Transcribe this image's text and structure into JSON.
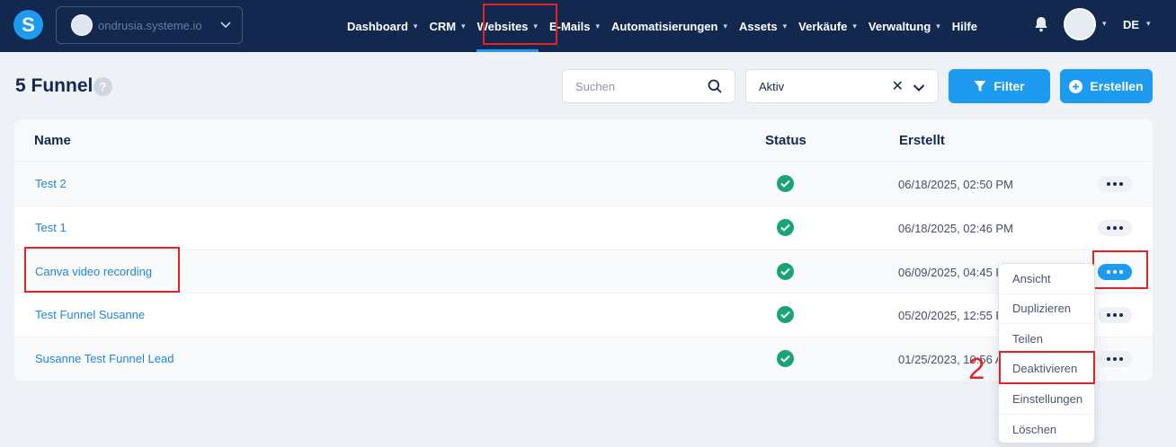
{
  "topbar": {
    "logo_letter": "S",
    "account_name": "ondrusia.systeme.io",
    "nav": [
      {
        "label": "Dashboard"
      },
      {
        "label": "CRM"
      },
      {
        "label": "Websites"
      },
      {
        "label": "E-Mails"
      },
      {
        "label": "Automatisierungen"
      },
      {
        "label": "Assets"
      },
      {
        "label": "Verkäufe"
      },
      {
        "label": "Verwaltung"
      },
      {
        "label": "Hilfe"
      }
    ],
    "language": "DE"
  },
  "header": {
    "title": "5 Funnel",
    "help": "?",
    "search_placeholder": "Suchen",
    "status_filter_value": "Aktiv",
    "filter_label": "Filter",
    "create_label": "Erstellen"
  },
  "table": {
    "columns": {
      "name": "Name",
      "status": "Status",
      "created": "Erstellt"
    },
    "rows": [
      {
        "name": "Test 2",
        "created": "06/18/2025, 02:50 PM"
      },
      {
        "name": "Test 1",
        "created": "06/18/2025, 02:46 PM"
      },
      {
        "name": "Canva video recording",
        "created": "06/09/2025, 04:45 PM"
      },
      {
        "name": "Test Funnel Susanne",
        "created": "05/20/2025, 12:55 PM"
      },
      {
        "name": "Susanne Test Funnel Lead",
        "created": "01/25/2023, 10:56 AM"
      }
    ]
  },
  "row_menu": {
    "items": [
      "Ansicht",
      "Duplizieren",
      "Teilen",
      "Deaktivieren",
      "Einstellungen",
      "Löschen"
    ]
  },
  "annotation": {
    "step": "2"
  },
  "colors": {
    "nav_bg": "#13284f",
    "accent": "#1d9bf0",
    "success": "#18a477",
    "highlight": "#e02424"
  }
}
